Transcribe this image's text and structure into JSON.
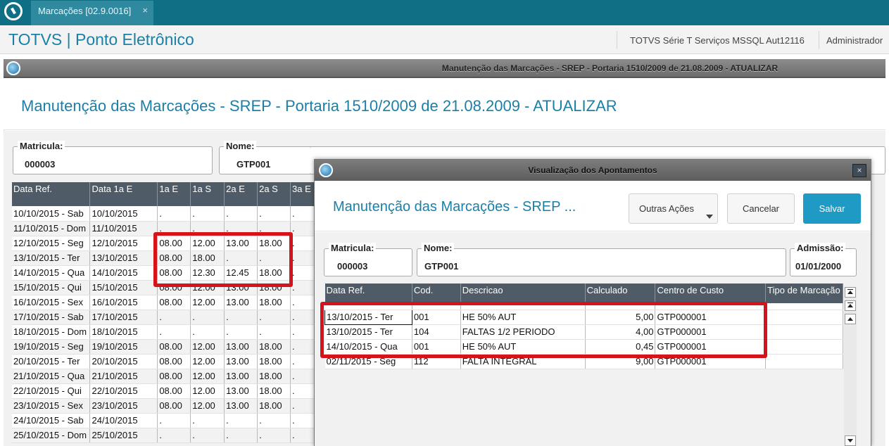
{
  "tab": {
    "label": "Marcações [02.9.0016]",
    "close": "×"
  },
  "header": {
    "app_title": "TOTVS | Ponto Eletrônico",
    "company": "TOTVS Série T Serviços MSSQL Aut12116",
    "user": "Administrador"
  },
  "window": {
    "title": "Manutenção das Marcações - SREP - Portaria 1510/2009 de 21.08.2009 - ATUALIZAR"
  },
  "main": {
    "title": "Manutenção das Marcações - SREP - Portaria 1510/2009 de 21.08.2009 - ATUALIZAR",
    "matricula_label": "Matricula:",
    "matricula": "000003",
    "nome_label": "Nome:",
    "nome": "GTP001",
    "columns": [
      "Data Ref.",
      "Data 1a E",
      "1a E",
      "1a S",
      "2a E",
      "2a S",
      "3a E"
    ],
    "rows": [
      [
        "10/10/2015 - Sab",
        "10/10/2015",
        ".",
        ".",
        ".",
        ".",
        "."
      ],
      [
        "11/10/2015 - Dom",
        "11/10/2015",
        ".",
        ".",
        ".",
        ".",
        "."
      ],
      [
        "12/10/2015 - Seg",
        "12/10/2015",
        "08.00",
        "12.00",
        "13.00",
        "18.00",
        "."
      ],
      [
        "13/10/2015 - Ter",
        "13/10/2015",
        "08.00",
        "18.00",
        ".",
        ".",
        "."
      ],
      [
        "14/10/2015 - Qua",
        "14/10/2015",
        "08.00",
        "12.30",
        "12.45",
        "18.00",
        "."
      ],
      [
        "15/10/2015 - Qui",
        "15/10/2015",
        "08.00",
        "12.00",
        "13.00",
        "18.00",
        "."
      ],
      [
        "16/10/2015 - Sex",
        "16/10/2015",
        "08.00",
        "12.00",
        "13.00",
        "18.00",
        "."
      ],
      [
        "17/10/2015 - Sab",
        "17/10/2015",
        ".",
        ".",
        ".",
        ".",
        "."
      ],
      [
        "18/10/2015 - Dom",
        "18/10/2015",
        ".",
        ".",
        ".",
        ".",
        "."
      ],
      [
        "19/10/2015 - Seg",
        "19/10/2015",
        "08.00",
        "12.00",
        "13.00",
        "18.00",
        "."
      ],
      [
        "20/10/2015 - Ter",
        "20/10/2015",
        "08.00",
        "12.00",
        "13.00",
        "18.00",
        "."
      ],
      [
        "21/10/2015 - Qua",
        "21/10/2015",
        "08.00",
        "12.00",
        "13.00",
        "18.00",
        "."
      ],
      [
        "22/10/2015 - Qui",
        "22/10/2015",
        "08.00",
        "12.00",
        "13.00",
        "18.00",
        "."
      ],
      [
        "23/10/2015 - Sex",
        "23/10/2015",
        "08.00",
        "12.00",
        "13.00",
        "18.00",
        "."
      ],
      [
        "24/10/2015 - Sab",
        "24/10/2015",
        ".",
        ".",
        ".",
        ".",
        "."
      ],
      [
        "25/10/2015 - Dom",
        "25/10/2015",
        ".",
        ".",
        ".",
        ".",
        "."
      ]
    ]
  },
  "modal": {
    "bar_title": "Visualização dos Apontamentos",
    "close": "×",
    "title": "Manutenção das Marcações - SREP ...",
    "buttons": {
      "outras": "Outras Ações",
      "cancel": "Cancelar",
      "save": "Salvar"
    },
    "matricula_label": "Matricula:",
    "matricula": "000003",
    "nome_label": "Nome:",
    "nome": "GTP001",
    "admissao_label": "Admissão:",
    "admissao": "01/01/2000",
    "columns": [
      "Data Ref.",
      "Cod.",
      "Descricao",
      "Calculado",
      "Centro de Custo",
      "Tipo de Marcação"
    ],
    "rows": [
      [
        "13/10/2015 - Ter",
        "001",
        "HE 50% AUT",
        "5,00",
        "GTP000001",
        ""
      ],
      [
        "13/10/2015 - Ter",
        "104",
        "FALTAS 1/2  PERIODO",
        "4,00",
        "GTP000001",
        ""
      ],
      [
        "14/10/2015 - Qua",
        "001",
        "HE 50% AUT",
        "0,45",
        "GTP000001",
        ""
      ],
      [
        "02/11/2015 - Seg",
        "112",
        "FALTA INTEGRAL",
        "9,00",
        "GTP000001",
        ""
      ]
    ]
  },
  "colors": {
    "accent": "#1b7fa6",
    "tabbar": "#0f6f85",
    "highlight": "#d4131a",
    "save": "#1e9ac4"
  }
}
